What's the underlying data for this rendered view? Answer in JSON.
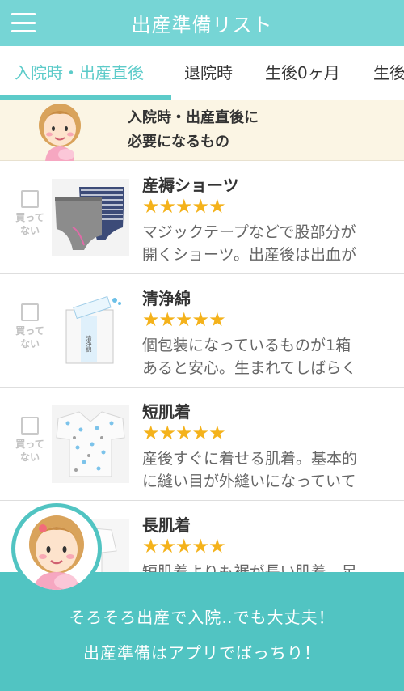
{
  "header": {
    "title": "出産準備リスト"
  },
  "tabs": [
    {
      "label": "入院時・出産直後",
      "active": true
    },
    {
      "label": "退院時",
      "active": false
    },
    {
      "label": "生後0ヶ月",
      "active": false
    },
    {
      "label": "生後",
      "active": false
    }
  ],
  "section": {
    "title_line1": "入院時・出産直後に",
    "title_line2": "必要になるもの"
  },
  "check_label_line1": "買って",
  "check_label_line2": "ない",
  "items": [
    {
      "name": "産褥ショーツ",
      "stars": "★★★★★",
      "rating": 5,
      "desc_line1": "マジックテープなどで股部分が",
      "desc_line2": "開くショーツ。出産後は出血が"
    },
    {
      "name": "清浄綿",
      "stars": "★★★★★",
      "rating": 5,
      "package_label": "清浄綿",
      "desc_line1": "個包装になっているものが1箱",
      "desc_line2": "あると安心。生まれてしばらく"
    },
    {
      "name": "短肌着",
      "stars": "★★★★★",
      "rating": 5,
      "desc_line1": "産後すぐに着せる肌着。基本的",
      "desc_line2": "に縫い目が外縫いになっていて"
    },
    {
      "name": "長肌着",
      "stars": "★★★★★",
      "rating": 5,
      "desc_line1": "短肌着よりも裾が長い肌着。足",
      "desc_line2": ""
    }
  ],
  "promo": {
    "line1": "そろそろ出産で入院‥でも大丈夫！",
    "line2": "出産準備はアプリでばっちり！"
  },
  "colors": {
    "header": "#76d5d5",
    "accent": "#5ccbc9",
    "banner_bg": "#fbf5e4",
    "star": "#f4b21b",
    "promo_bg": "#51c4c2"
  }
}
